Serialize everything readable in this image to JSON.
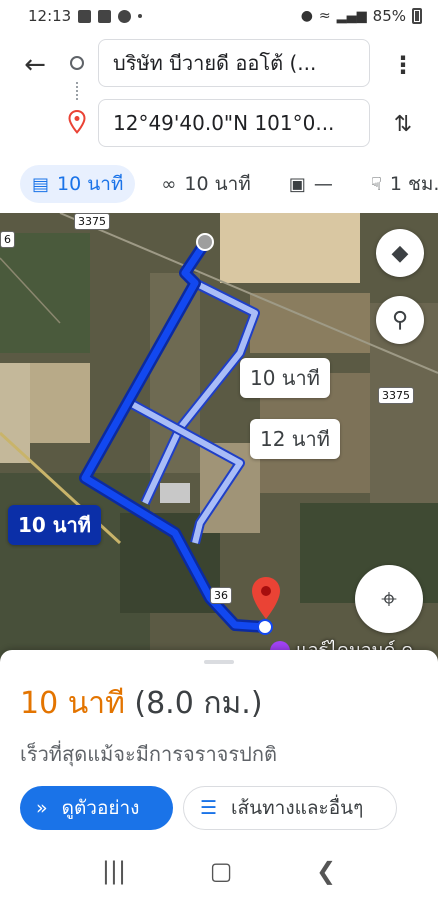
{
  "status_bar": {
    "time": "12:13",
    "battery": "85%"
  },
  "route": {
    "origin": "บริษัท บีวายดี ออโต้ (...",
    "destination": "12°49'40.0\"N 101°0..."
  },
  "modes": [
    {
      "name": "car",
      "label": "10 นาที",
      "active": true
    },
    {
      "name": "motorcycle",
      "label": "10 นาที",
      "active": false
    },
    {
      "name": "transit",
      "label": "—",
      "active": false
    },
    {
      "name": "walk",
      "label": "1 ชม.",
      "active": false
    }
  ],
  "map": {
    "route_labels": {
      "primary": "10 นาที",
      "alt1": "10 นาที",
      "alt2": "12 นาที"
    },
    "road_shields": [
      "3375",
      "3375",
      "36",
      "6"
    ],
    "poi_label": "แอร์ไดมอนด์ ค",
    "colors": {
      "primary_route": "#0d3bd6",
      "alt_route": "#9db3f5",
      "pin": "#ea4335"
    }
  },
  "sheet": {
    "duration": "10 นาที",
    "distance": "(8.0 กม.)",
    "description": "เร็วที่สุดแม้จะมีการจราจรปกติ",
    "preview_button": "ดูตัวอย่าง",
    "steps_button": "เส้นทางและอื่นๆ",
    "colors": {
      "duration": "#e37400",
      "accent": "#1a73e8"
    }
  }
}
